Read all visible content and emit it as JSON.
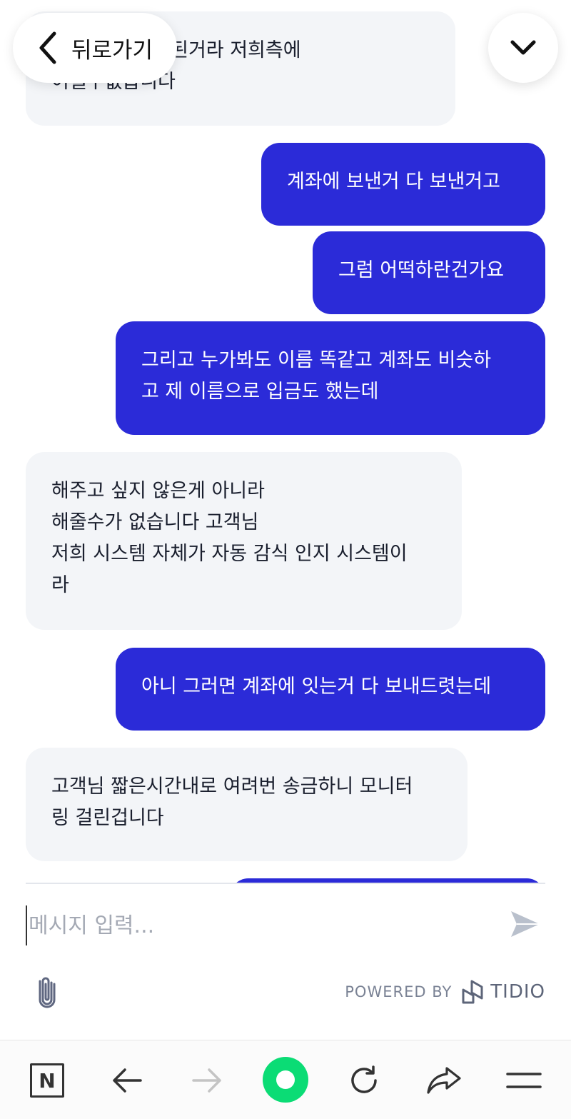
{
  "header": {
    "back_label": "뒤로가기",
    "back_icon": "chevron-left-icon",
    "collapse_icon": "chevron-down-icon"
  },
  "messages": [
    {
      "sender": "operator",
      "text": "...수로 이렇게 된거라 저희측에\n어쩔수없습니다"
    },
    {
      "sender": "visitor",
      "text": "계좌에 보낸거 다 보낸거고"
    },
    {
      "sender": "visitor",
      "text": "그럼 어떡하란건가요"
    },
    {
      "sender": "visitor",
      "text": "그리고 누가봐도 이름 똑같고 계좌도 비슷하\n고 제 이름으로 입금도 했는데"
    },
    {
      "sender": "operator",
      "text": "해주고 싶지 않은게 아니라\n해줄수가 없습니다 고객님\n저희 시스템 자체가 자동 감식 인지 시스템이\n라"
    },
    {
      "sender": "visitor",
      "text": "아니 그러면 계좌에 잇는거 다 보내드렷는데"
    },
    {
      "sender": "operator",
      "text": "고객님 짧은시간내로 여려번 송금하니 모니터\n링 걸린겁니다"
    }
  ],
  "composer": {
    "placeholder": "메시지 입력...",
    "value": "",
    "send_icon": "send-icon",
    "attach_icon": "paperclip-icon"
  },
  "footer": {
    "powered_by": "POWERED BY",
    "brand": "TIDIO",
    "brand_icon": "tidio-logo-icon"
  },
  "browser_bar": {
    "items": [
      "naver-n-icon",
      "back-arrow-icon",
      "forward-arrow-icon",
      "green-dot-icon",
      "refresh-icon",
      "share-icon",
      "menu-icon"
    ]
  },
  "colors": {
    "visitor_bubble": "#2b2bd8",
    "operator_bubble": "#f3f5f8",
    "accent_green": "#0bdc75"
  }
}
